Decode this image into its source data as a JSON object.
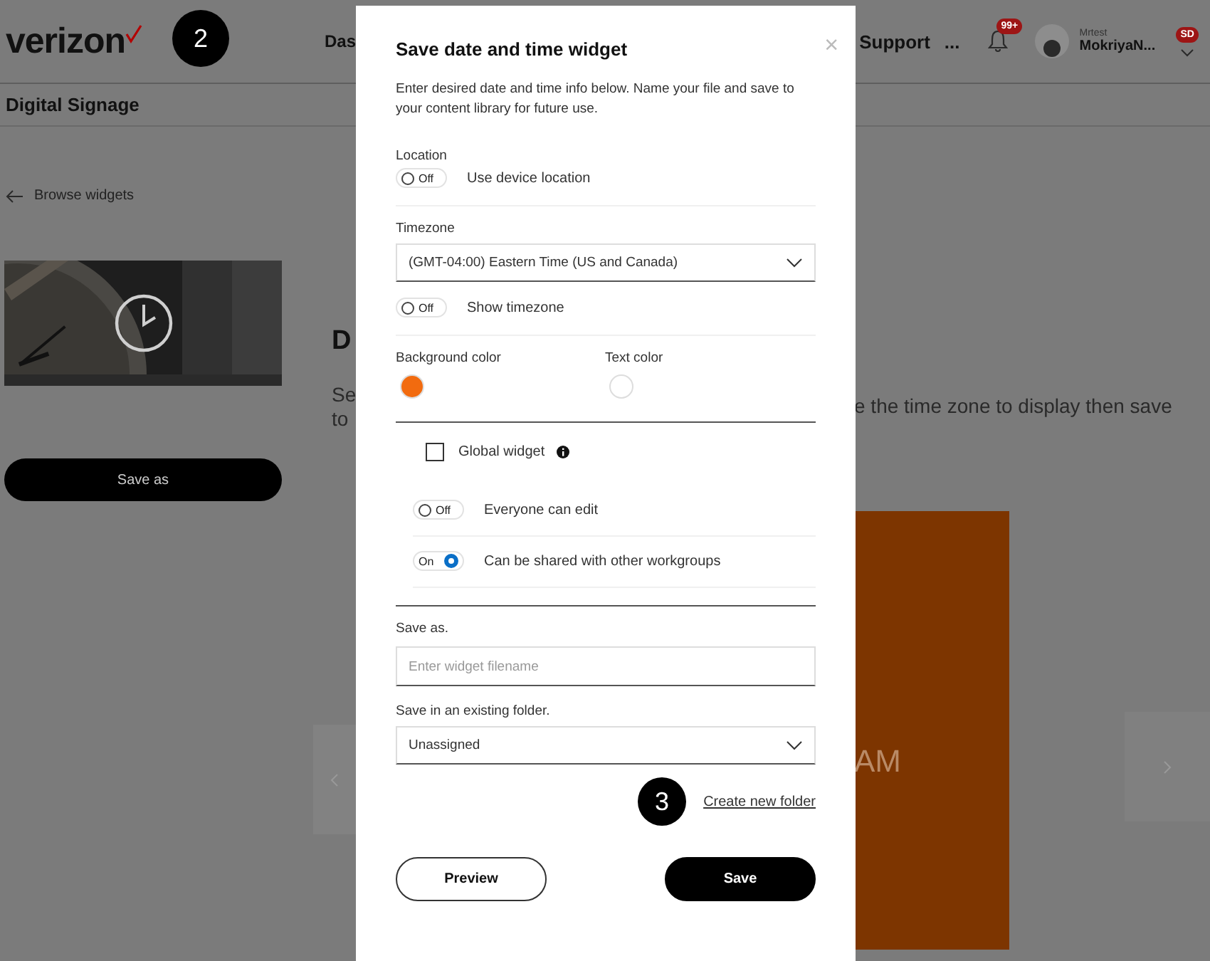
{
  "header": {
    "logo": "verizon",
    "nav": [
      "Das",
      "Support",
      "..."
    ],
    "notification_badge": "99+",
    "user": {
      "role": "Mrtest",
      "name": "MokriyaN...",
      "badge": "SD"
    }
  },
  "subheader": "Digital Signage",
  "back_link": "Browse widgets",
  "save_as_button": "Save as",
  "widget": {
    "heading": "D",
    "description_left": [
      "Se",
      "to"
    ],
    "description_right": "e the time zone to display then save",
    "preview_text": "AM"
  },
  "annotations": [
    "2",
    "3"
  ],
  "dialog": {
    "title": "Save date and time widget",
    "close": "×",
    "description": "Enter desired date and time info below. Name your file and save to your content library for future use.",
    "location": {
      "label": "Location",
      "toggle": {
        "on": false,
        "state_text": "Off",
        "label": "Use device location"
      }
    },
    "timezone": {
      "label": "Timezone",
      "value": "(GMT-04:00) Eastern Time (US and Canada)",
      "toggle": {
        "on": false,
        "state_text": "Off",
        "label": "Show timezone"
      }
    },
    "colors": [
      {
        "label": "Background color",
        "color": "#f26b0f"
      },
      {
        "label": "Text color",
        "color": "#ffffff"
      }
    ],
    "global_widget": {
      "label": "Global widget",
      "checked": false
    },
    "permissions": [
      {
        "on": false,
        "state_text": "Off",
        "label": "Everyone can edit"
      },
      {
        "on": true,
        "state_text": "On",
        "label": "Can be shared with other workgroups"
      }
    ],
    "save_as": {
      "label": "Save as.",
      "placeholder": "Enter widget filename"
    },
    "folder": {
      "label": "Save in an existing folder.",
      "value": "Unassigned"
    },
    "create_folder": "Create new folder",
    "buttons": [
      {
        "kind": "secondary",
        "label": "Preview"
      },
      {
        "kind": "primary",
        "label": "Save"
      }
    ]
  }
}
